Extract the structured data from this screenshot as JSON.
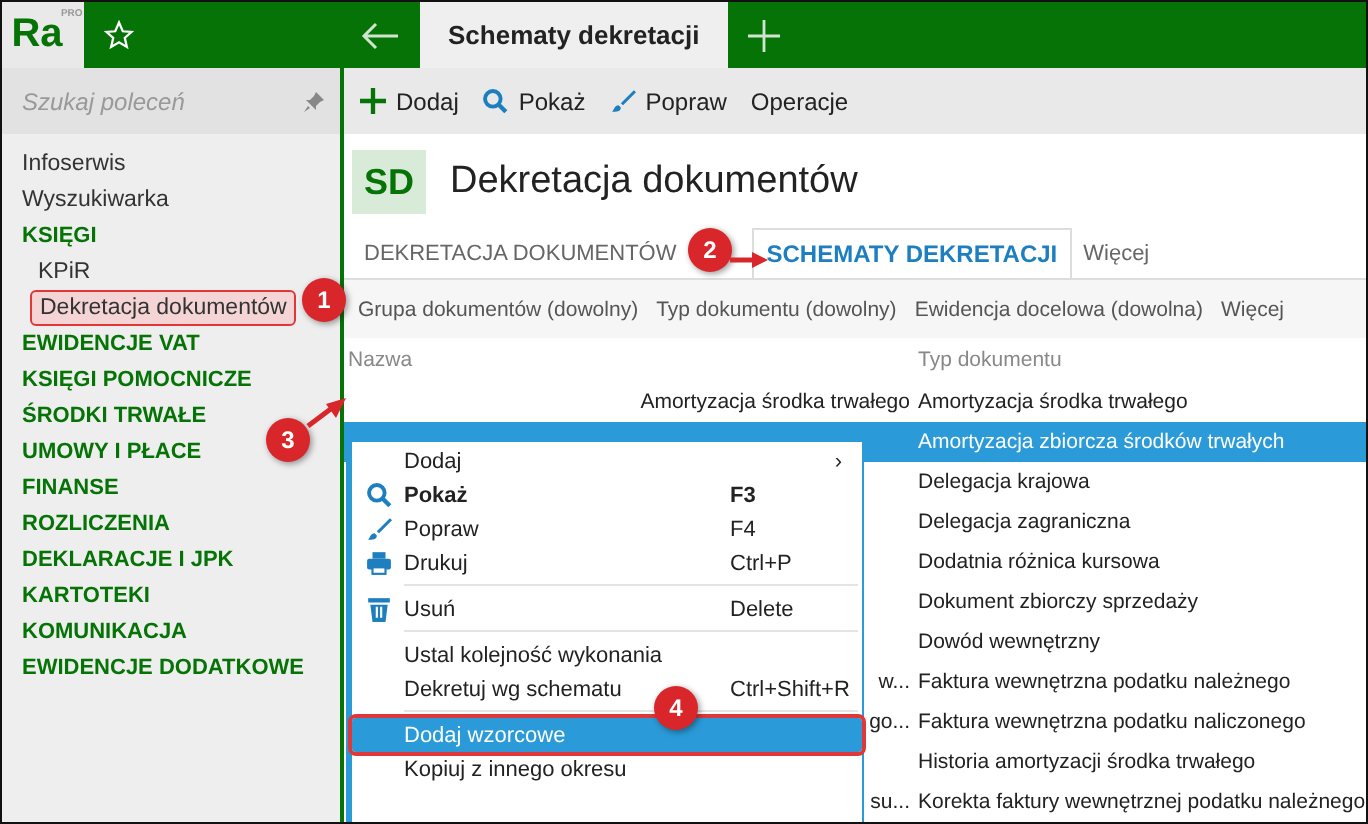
{
  "app": {
    "logo": "Ra",
    "logo_badge": "PRO",
    "tab_title": "Schematy dekretacji"
  },
  "sidebar": {
    "search": {
      "placeholder": "Szukaj poleceń"
    },
    "items": [
      {
        "label": "Infoserwis",
        "kind": "link",
        "selected": false
      },
      {
        "label": "Wyszukiwarka",
        "kind": "link",
        "selected": false
      },
      {
        "label": "KSIĘGI",
        "kind": "section",
        "selected": false,
        "children": [
          {
            "label": "KPiR",
            "kind": "link",
            "selected": false
          },
          {
            "label": "Dekretacja dokumentów",
            "kind": "link",
            "selected": true
          }
        ]
      },
      {
        "label": "EWIDENCJE VAT",
        "kind": "section",
        "selected": false
      },
      {
        "label": "KSIĘGI POMOCNICZE",
        "kind": "section",
        "selected": false
      },
      {
        "label": "ŚRODKI TRWAŁE",
        "kind": "section",
        "selected": false
      },
      {
        "label": "UMOWY I PŁACE",
        "kind": "section",
        "selected": false
      },
      {
        "label": "FINANSE",
        "kind": "section",
        "selected": false
      },
      {
        "label": "ROZLICZENIA",
        "kind": "section",
        "selected": false
      },
      {
        "label": "DEKLARACJE I JPK",
        "kind": "section",
        "selected": false
      },
      {
        "label": "KARTOTEKI",
        "kind": "section",
        "selected": false
      },
      {
        "label": "KOMUNIKACJA",
        "kind": "section",
        "selected": false
      },
      {
        "label": "EWIDENCJE DODATKOWE",
        "kind": "section",
        "selected": false
      }
    ]
  },
  "toolbar": [
    "Dodaj",
    "Pokaż",
    "Popraw",
    "Operacje"
  ],
  "page": {
    "badge": "SD",
    "title": "Dekretacja dokumentów"
  },
  "tabs": [
    {
      "label": "DEKRETACJA DOKUMENTÓW",
      "selected": false
    },
    {
      "label": "SCHEMATY DEKRETACJI",
      "selected": true
    },
    {
      "label": "Więcej",
      "selected": false
    }
  ],
  "filters": [
    "Grupa dokumentów (dowolny)",
    "Typ dokumentu (dowolny)",
    "Ewidencja docelowa (dowolna)",
    "Więcej"
  ],
  "table": {
    "columns": [
      "Nazwa",
      "Typ dokumentu"
    ],
    "rows": [
      {
        "name": "Amortyzacja środka trwałego",
        "type": "Amortyzacja środka trwałego",
        "selected": false
      },
      {
        "type": "Amortyzacja zbiorcza środków trwałych",
        "selected": true
      },
      {
        "type": "Delegacja krajowa",
        "selected": false
      },
      {
        "type": "Delegacja zagraniczna",
        "selected": false
      },
      {
        "type": "Dodatnia różnica kursowa",
        "selected": false
      },
      {
        "type": "Dokument zbiorczy sprzedaży",
        "selected": false
      },
      {
        "type": "Dowód wewnętrzny",
        "selected": false
      },
      {
        "name": "w...",
        "type": "Faktura wewnętrzna podatku należnego",
        "selected": false
      },
      {
        "name": "go...",
        "type": "Faktura wewnętrzna podatku naliczonego",
        "selected": false
      },
      {
        "type": "Historia amortyzacji środka trwałego",
        "selected": false
      },
      {
        "name": "su...",
        "type": "Korekta faktury wewnętrznej podatku należnego",
        "selected": false
      }
    ]
  },
  "context_menu": [
    {
      "kind": "item",
      "label": "Dodaj",
      "submenu": "›",
      "selected": false
    },
    {
      "kind": "item",
      "label": "Pokaż",
      "shortcut": "F3",
      "bold": true,
      "selected": false
    },
    {
      "kind": "item",
      "label": "Popraw",
      "shortcut": "F4",
      "selected": false
    },
    {
      "kind": "item",
      "label": "Drukuj",
      "shortcut": "Ctrl+P",
      "selected": false
    },
    {
      "kind": "separator"
    },
    {
      "kind": "item",
      "label": "Usuń",
      "shortcut": "Delete",
      "selected": false
    },
    {
      "kind": "separator"
    },
    {
      "kind": "item",
      "label": "Ustal kolejność wykonania",
      "selected": false
    },
    {
      "kind": "item",
      "label": "Dekretuj wg schematu",
      "shortcut": "Ctrl+Shift+R",
      "selected": false
    },
    {
      "kind": "separator"
    },
    {
      "kind": "item",
      "label": "Dodaj wzorcowe",
      "selected": true
    },
    {
      "kind": "item",
      "label": "Kopiuj z innego okresu",
      "selected": false
    }
  ],
  "callouts": [
    "1",
    "2",
    "3",
    "4"
  ]
}
